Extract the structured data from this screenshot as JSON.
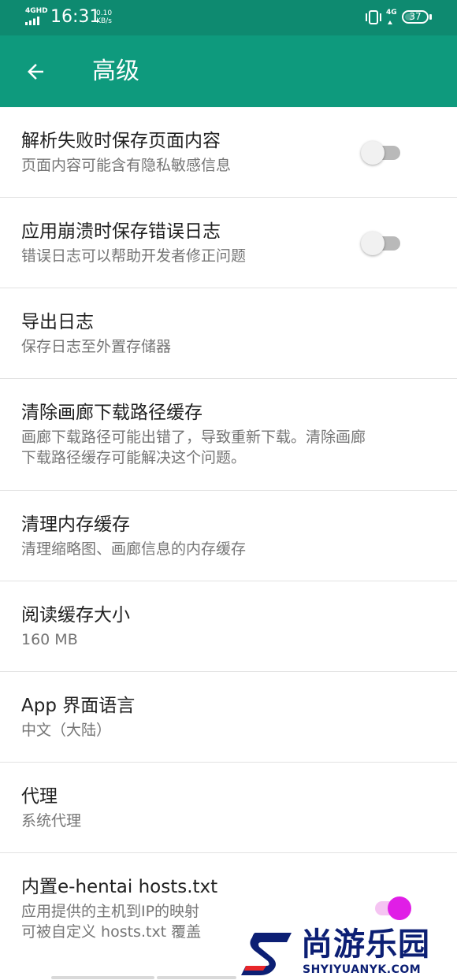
{
  "status_bar": {
    "network": "4GHD",
    "time": "16:31",
    "speed_value": "0.10",
    "speed_unit": "KB/s",
    "network_right": "4G",
    "battery_level": "37"
  },
  "app_bar": {
    "title": "高级",
    "back_icon": "arrow-left-icon"
  },
  "settings": [
    {
      "title": "解析失败时保存页面内容",
      "summary": "页面内容可能含有隐私敏感信息",
      "switch": false
    },
    {
      "title": "应用崩溃时保存错误日志",
      "summary": "错误日志可以帮助开发者修正问题",
      "switch": false
    },
    {
      "title": "导出日志",
      "summary": "保存日志至外置存储器"
    },
    {
      "title": "清除画廊下载路径缓存",
      "summary_line1": "画廊下载路径可能出错了，导致重新下载。清除画廊",
      "summary_line2": "下载路径缓存可能解决这个问题。"
    },
    {
      "title": "清理内存缓存",
      "summary": "清理缩略图、画廊信息的内存缓存"
    },
    {
      "title": "阅读缓存大小",
      "summary": "160 MB"
    },
    {
      "title": "App 界面语言",
      "summary": "中文（大陆）"
    },
    {
      "title": "代理",
      "summary": "系统代理"
    },
    {
      "title": "内置e-hentai hosts.txt",
      "summary_line1": "应用提供的主机到IP的映射",
      "summary_line2": "可被自定义 hosts.txt 覆盖",
      "switch": true
    }
  ],
  "watermark": {
    "name": "尚游乐园",
    "domain": "SHYIYUANYK.COM"
  },
  "colors": {
    "status_bar": "#0e8a70",
    "app_bar": "#0e9a7d",
    "switch_on": "#e01ee6"
  }
}
